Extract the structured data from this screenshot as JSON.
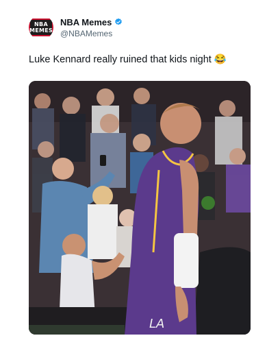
{
  "account": {
    "display_name": "NBA Memes",
    "handle": "@NBAMemes",
    "logo_line1": "NBA",
    "logo_line2": "MEMES",
    "verified": true,
    "verified_color": "#1d9bf0"
  },
  "tweet": {
    "text": "Luke Kennard really ruined that kids night 😂"
  },
  "media": {
    "alt": "Basketball player in purple Lakers uniform walking past crowd while a child reaches out",
    "jersey_color": "#5b3a8c",
    "crowd_tone": "#3a3034"
  }
}
